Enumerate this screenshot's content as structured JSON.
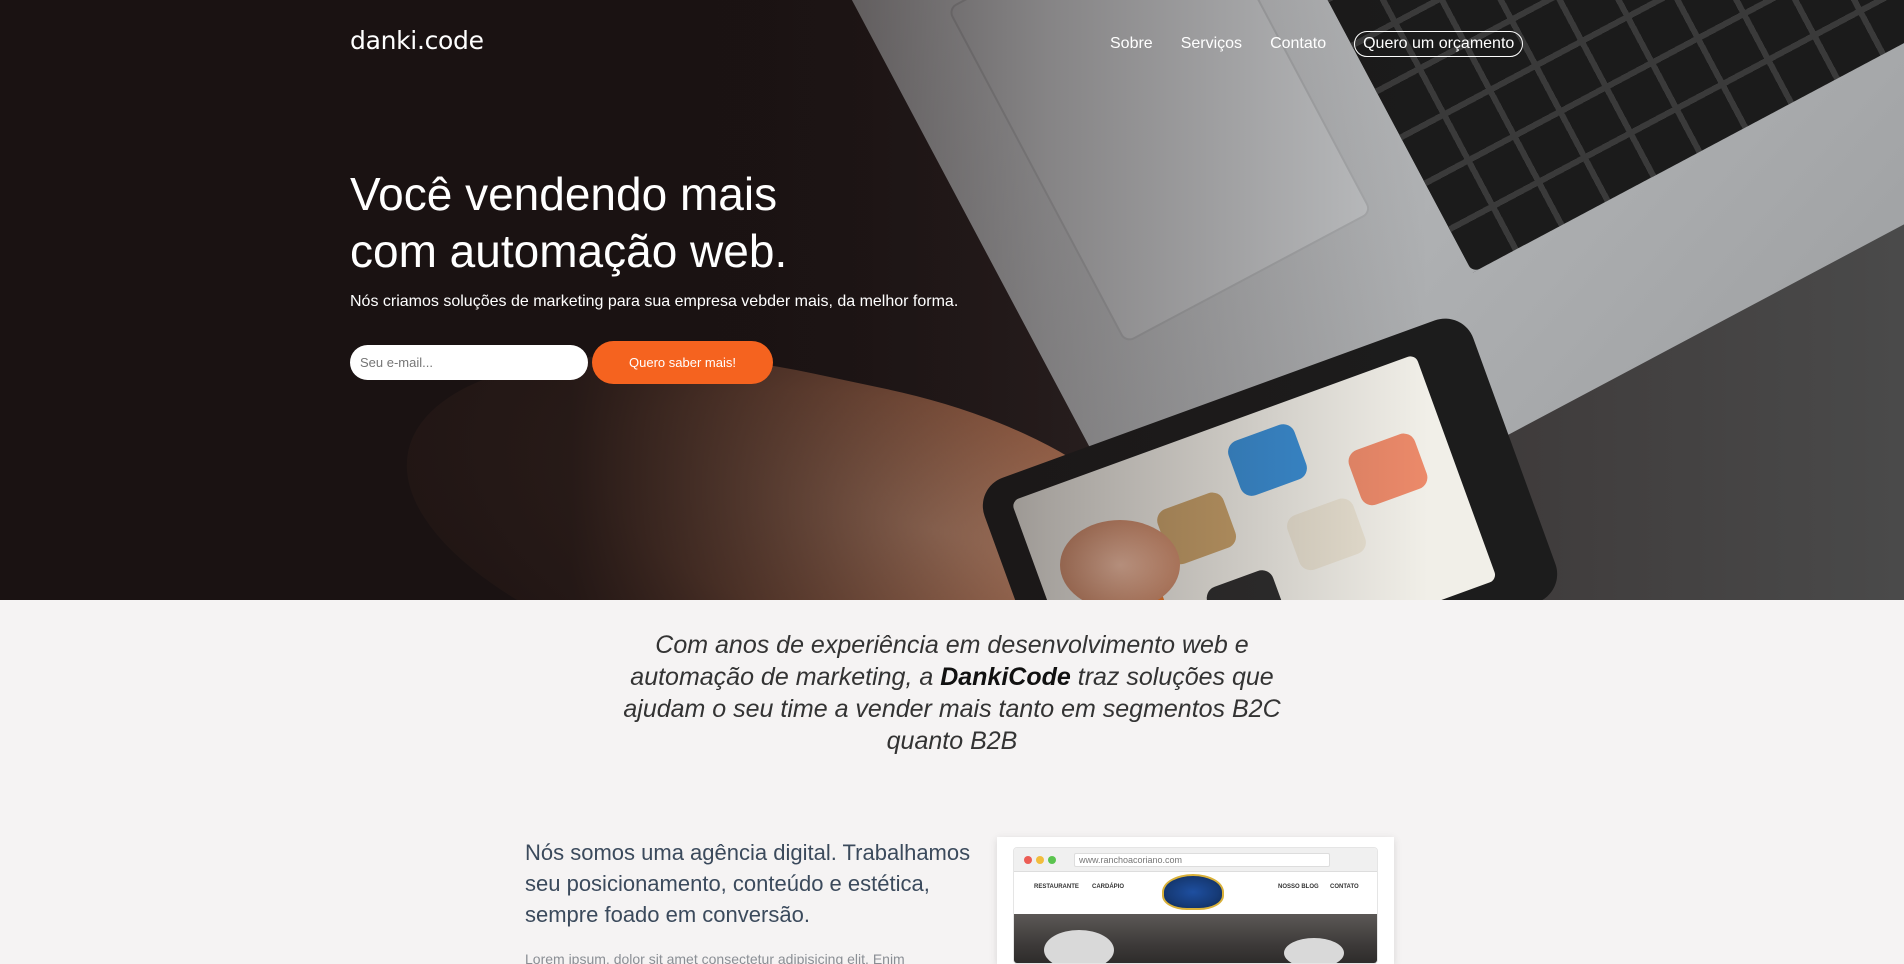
{
  "header": {
    "logo": "danki.code",
    "nav": [
      "Sobre",
      "Serviços",
      "Contato"
    ],
    "quote_button": "Quero um orçamento"
  },
  "hero": {
    "headline_line1": "Você vendendo mais",
    "headline_line2": "com automação web.",
    "subtitle": "Nós criamos soluções de marketing para sua empresa vebder mais, da melhor forma.",
    "email_placeholder": "Seu e-mail...",
    "cta_label": "Quero saber mais!"
  },
  "intro": {
    "text_before": "Com anos de experiência em desenvolvimento web e automação de marketing, a ",
    "brand": "DankiCode",
    "text_after": " traz soluções que ajudam o seu time a vender mais tanto em segmentos B2C quanto B2B"
  },
  "agency": {
    "title": "Nós somos uma agência digital. Trabalhamos seu posicionamento, conteúdo e estética, sempre foado em conversão.",
    "lorem": "Lorem ipsum, dolor sit amet consectetur adipisicing elit. Enim"
  },
  "mockup": {
    "url": "www.ranchoacoriano.com",
    "nav_left": [
      "RESTAURANTE",
      "CARDÁPIO"
    ],
    "nav_right": [
      "NOSSO BLOG",
      "CONTATO"
    ]
  },
  "colors": {
    "accent": "#f5631f",
    "hero_dark": "#1a1212",
    "text_blue": "#3b4a5c"
  }
}
